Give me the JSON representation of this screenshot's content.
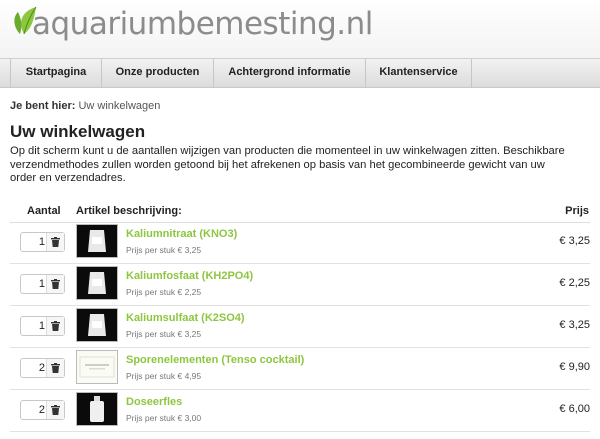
{
  "brand": {
    "logo_text": "aquariumbemesting.nl"
  },
  "nav": [
    {
      "label": "Startpagina"
    },
    {
      "label": "Onze producten"
    },
    {
      "label": "Achtergrond informatie"
    },
    {
      "label": "Klantenservice"
    }
  ],
  "breadcrumb": {
    "prefix": "Je bent hier:",
    "current": "Uw winkelwagen"
  },
  "page": {
    "title": "Uw winkelwagen",
    "intro": "Op dit scherm kunt u de aantallen wijzigen van producten die momenteel in uw winkelwagen zitten. Beschikbare verzendmethodes zullen worden getoond bij het afrekenen op basis van het gecombineerde gewicht van uw order en verzendadres."
  },
  "table": {
    "headers": {
      "qty": "Aantal",
      "desc": "Artikel beschrijving:",
      "price": "Prijs"
    },
    "rows": [
      {
        "qty": "1",
        "name": "Kaliumnitraat (KNO3)",
        "unit": "Prijs per stuk € 3,25",
        "price": "€ 3,25",
        "thumb": "bag-dark"
      },
      {
        "qty": "1",
        "name": "Kaliumfosfaat (KH2PO4)",
        "unit": "Prijs per stuk € 2,25",
        "price": "€ 2,25",
        "thumb": "bag-dark"
      },
      {
        "qty": "1",
        "name": "Kaliumsulfaat (K2SO4)",
        "unit": "Prijs per stuk € 3,25",
        "price": "€ 3,25",
        "thumb": "bag-dark"
      },
      {
        "qty": "2",
        "name": "Sporenelementen (Tenso cocktail)",
        "unit": "Prijs per stuk € 4,95",
        "price": "€ 9,90",
        "thumb": "label-light"
      },
      {
        "qty": "2",
        "name": "Doseerfles",
        "unit": "Prijs per stuk € 3,00",
        "price": "€ 6,00",
        "thumb": "bottle-dark"
      }
    ]
  },
  "colors": {
    "accent": "#8dc63f",
    "logo_text": "#8c8c8c"
  }
}
